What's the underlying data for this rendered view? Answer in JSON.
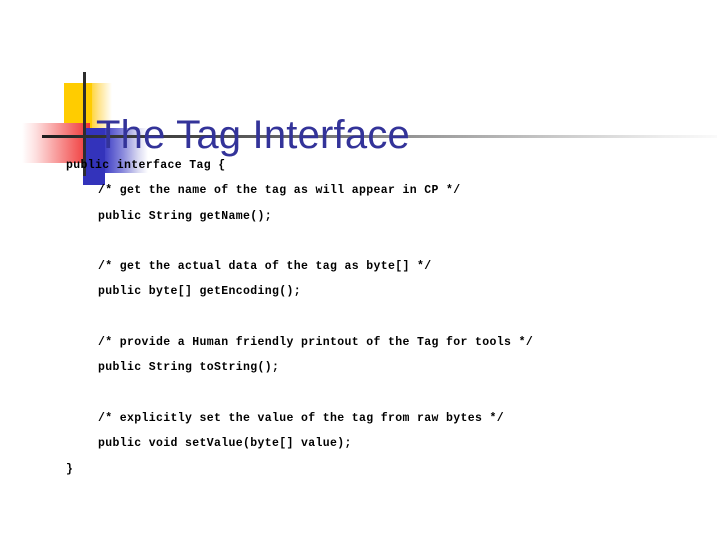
{
  "slide": {
    "title": "The Tag Interface",
    "title_color": "#333399",
    "background_color": "#ffffff"
  },
  "logo": {
    "yellow_color": "#FFCC00",
    "red_color": "#F03434",
    "blue_color": "#3333BB",
    "rule_color": "#2D2D2D"
  },
  "code": {
    "lines": [
      {
        "text": "public interface Tag {",
        "indent": 0
      },
      {
        "text": "/* get the name of the tag as will appear in CP */",
        "indent": 1
      },
      {
        "text": "public String getName();",
        "indent": 1
      },
      {
        "text": "",
        "indent": 0
      },
      {
        "text": "/* get the actual data of the tag as byte[] */",
        "indent": 1
      },
      {
        "text": "public byte[] getEncoding();",
        "indent": 1
      },
      {
        "text": "",
        "indent": 0
      },
      {
        "text": "/* provide a Human friendly printout of the Tag for tools */",
        "indent": 1
      },
      {
        "text": "public String toString();",
        "indent": 1
      },
      {
        "text": "",
        "indent": 0
      },
      {
        "text": "/* explicitly set the value of the tag from raw bytes */",
        "indent": 1
      },
      {
        "text": "public void setValue(byte[] value);",
        "indent": 1
      },
      {
        "text": "}",
        "indent": 0
      }
    ]
  }
}
